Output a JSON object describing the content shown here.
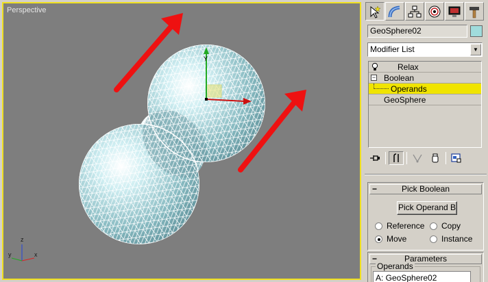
{
  "viewport": {
    "label": "Perspective",
    "axis": {
      "z": "z",
      "y": "y",
      "x": "x"
    }
  },
  "panel": {
    "tabs": [
      {
        "name": "create-tab",
        "icon": "cursor-star-icon"
      },
      {
        "name": "modify-tab",
        "icon": "bend-icon"
      },
      {
        "name": "hierarchy-tab",
        "icon": "hierarchy-icon"
      },
      {
        "name": "motion-tab",
        "icon": "motion-icon"
      },
      {
        "name": "display-tab",
        "icon": "display-icon"
      },
      {
        "name": "utilities-tab",
        "icon": "hammer-icon"
      }
    ],
    "object_name": "GeoSphere02",
    "object_color": "#a0dcdc",
    "modifier_list": "Modifier List",
    "stack": {
      "relax": "Relax",
      "boolean": "Boolean",
      "operands": "Operands",
      "geosphere": "GeoSphere"
    },
    "pick_boolean": {
      "title": "Pick Boolean",
      "pick_button": "Pick Operand B",
      "reference": "Reference",
      "copy": "Copy",
      "move": "Move",
      "instance": "Instance",
      "selected": "Move"
    },
    "parameters": {
      "title": "Parameters",
      "operands_label": "Operands",
      "operand_a": "A: GeoSphere02"
    }
  },
  "colors": {
    "viewport_bg": "#7e7e7e",
    "active_border": "#f0e020",
    "highlight": "#f0e400",
    "arrow": "#ee1111"
  }
}
